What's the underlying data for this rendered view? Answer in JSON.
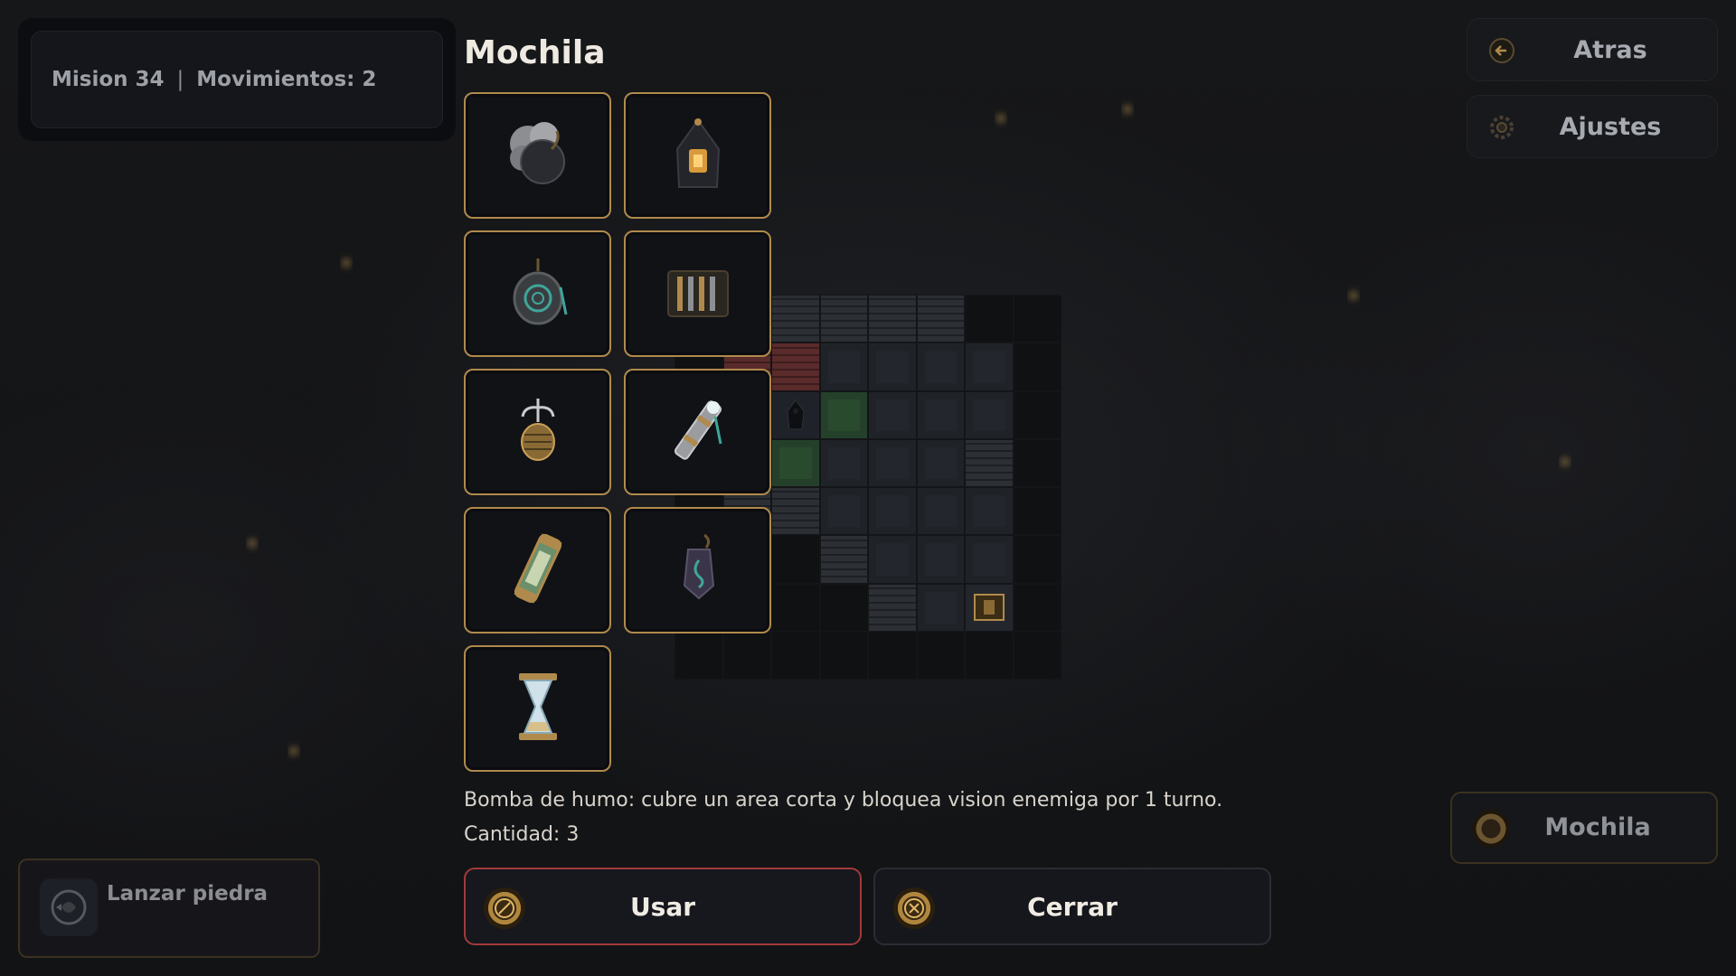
{
  "hud": {
    "mission": "Mision 34",
    "separator": "|",
    "moves": "Movimientos: 2"
  },
  "nav": {
    "back_label": "Atras",
    "back_icon": "arrow-left-icon",
    "settings_label": "Ajustes",
    "settings_icon": "gear-icon"
  },
  "inventory": {
    "title": "Mochila",
    "items": [
      {
        "icon": "smoke-bomb-icon"
      },
      {
        "icon": "hooded-lantern-icon"
      },
      {
        "icon": "rune-amulet-icon"
      },
      {
        "icon": "lockpick-kit-icon"
      },
      {
        "icon": "grappling-hook-icon"
      },
      {
        "icon": "spyglass-icon"
      },
      {
        "icon": "scroll-tube-icon"
      },
      {
        "icon": "rune-charm-icon"
      },
      {
        "icon": "hourglass-icon"
      }
    ],
    "selected_description": "Bomba de humo: cubre un area corta y bloquea vision enemiga por 1 turno.",
    "quantity": "Cantidad: 3"
  },
  "actions": {
    "use_label": "Usar",
    "close_label": "Cerrar"
  },
  "ability": {
    "label": "Lanzar piedra",
    "icon": "stone-throw-icon"
  },
  "backpack_button": {
    "label": "Mochila",
    "icon": "backpack-medallion-icon"
  },
  "colors": {
    "slot_border": "#b08a4c",
    "use_border": "#a23a3a",
    "accent_gold": "#b0863e"
  }
}
